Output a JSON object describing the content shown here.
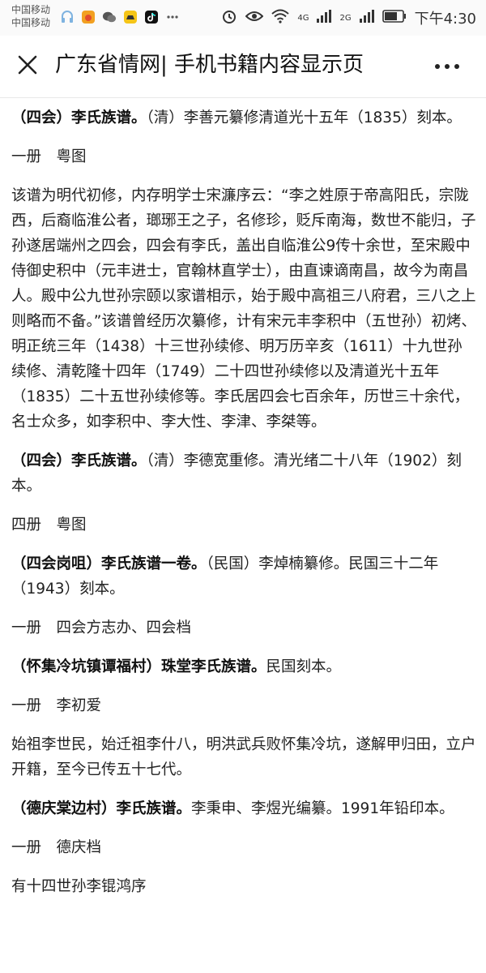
{
  "status": {
    "carrier1": "中国移动",
    "carrier2": "中国移动",
    "net1": "4G",
    "net2": "2G",
    "time": "下午4:30"
  },
  "nav": {
    "title": "广东省情网| 手机书籍内容显示页",
    "close_icon": "close-icon",
    "more_icon": "more-icon"
  },
  "entries": [
    {
      "title": "（四会）李氏族谱。",
      "text": "（清）李善元纂修清道光十五年（1835）刻本。",
      "meta": "一册 粤图"
    },
    {
      "title": "",
      "text": "该谱为明代初修，内存明学士宋濂序云：“李之姓原于帝高阳氏，宗陇西，后裔临淮公者，瑯琊王之子，名修珍，贬斥南海，数世不能归，子孙遂居端州之四会，四会有李氏，盖出自临淮公9传十余世，至宋殿中侍御史积中（元丰进士，官翰林直学士），由直谏谪南昌，故今为南昌人。殿中公九世孙宗颐以家谱相示，始于殿中高祖三八府君，三八之上则略而不备。”该谱曾经历次纂修，计有宋元丰李积中（五世孙）初烤、明正统三年（1438）十三世孙续修、明万历辛亥（1611）十九世孙续修、清乾隆十四年（1749）二十四世孙续修以及清道光十五年（1835）二十五世孙续修等。李氏居四会七百余年，历世三十余代，名士众多，如李积中、李大性、李津、李桀等。",
      "meta": ""
    },
    {
      "title": "（四会）李氏族谱。",
      "text": "（清）李德宽重修。清光绪二十八年（1902）刻本。",
      "meta": "四册 粤图"
    },
    {
      "title": "（四会岗咀）李氏族谱一卷。",
      "text": "（民国）李焯楠纂修。民国三十二年（1943）刻本。",
      "meta": "一册 四会方志办、四会档"
    },
    {
      "title": "（怀集冷坑镇谭福村）珠堂李氏族谱。",
      "text": "民国刻本。",
      "meta": "一册 李初爱"
    },
    {
      "title": "",
      "text": "始祖李世民，始迁祖李什八，明洪武兵败怀集冷坑，遂解甲归田，立户开籍，至今已传五十七代。",
      "meta": ""
    },
    {
      "title": "（德庆棠边村）李氏族谱。",
      "text": "李秉申、李煜光编纂。1991年铅印本。",
      "meta": "一册 德庆档"
    },
    {
      "title": "",
      "text": "有十四世孙李锟鸿序",
      "meta": ""
    }
  ]
}
